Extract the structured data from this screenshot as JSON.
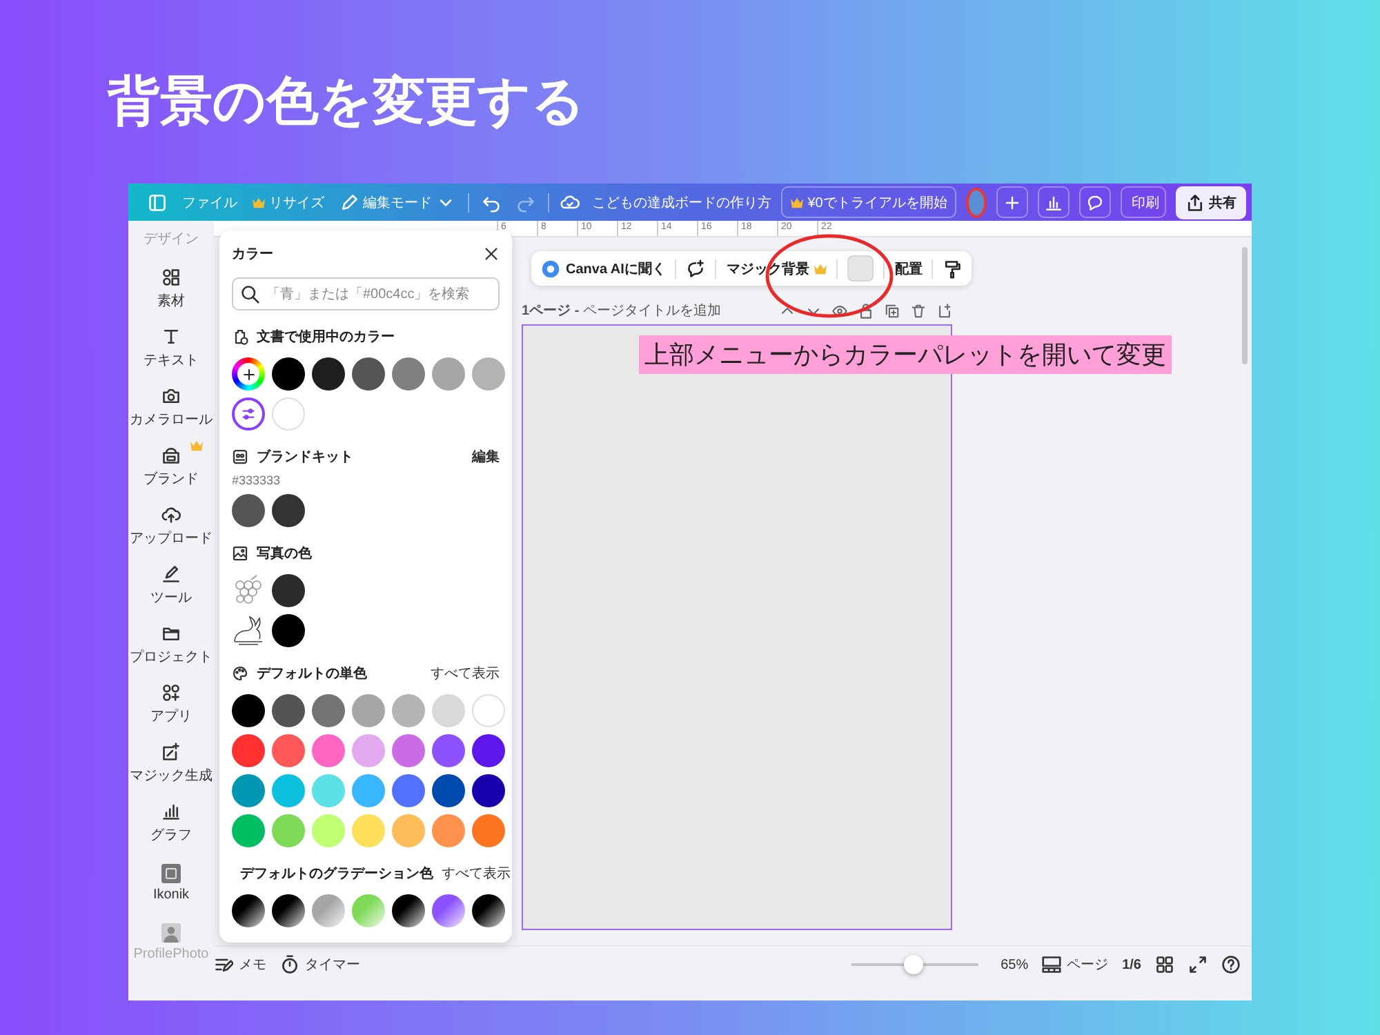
{
  "slide_title": "背景の色を変更する",
  "topbar": {
    "menu": [
      {
        "label": "ファイル",
        "premium": false
      },
      {
        "label": "リサイズ",
        "premium": true
      }
    ],
    "edit_mode": "編集モード",
    "redo_disabled": true,
    "doc_title": "こどもの達成ボードの作り方",
    "trial": {
      "label": "¥0でトライアルを開始",
      "premium": true
    },
    "avatar_circled": true,
    "print": "印刷",
    "share": "共有"
  },
  "rail": {
    "header": "デザイン",
    "items": [
      {
        "label": "素材",
        "premium": false
      },
      {
        "label": "テキスト",
        "premium": false
      },
      {
        "label": "カメラロール",
        "premium": false
      },
      {
        "label": "ブランド",
        "premium": true
      },
      {
        "label": "アップロード",
        "premium": false
      },
      {
        "label": "ツール",
        "premium": false
      },
      {
        "label": "プロジェクト",
        "premium": false
      },
      {
        "label": "アプリ",
        "premium": false
      },
      {
        "label": "マジック生成",
        "premium": false
      },
      {
        "label": "グラフ",
        "premium": false
      },
      {
        "label": "Ikonik",
        "premium": false
      },
      {
        "label": "ProfilePhoto",
        "premium": false
      }
    ]
  },
  "ruler": [
    "6",
    "8",
    "10",
    "12",
    "14",
    "16",
    "18",
    "20",
    "22"
  ],
  "color_panel": {
    "title": "カラー",
    "search": {
      "placeholder": "「青」または「#00c4cc」を検索"
    },
    "sections": [
      {
        "kind": "document",
        "header": "文書で使用中のカラー",
        "rows": [
          [
            {
              "kind": "add"
            },
            {
              "kind": "swatch",
              "color": "#000000"
            },
            {
              "kind": "swatch",
              "color": "#1f1f1f"
            },
            {
              "kind": "swatch",
              "color": "#555555"
            },
            {
              "kind": "swatch",
              "color": "#808080"
            },
            {
              "kind": "swatch",
              "color": "#a6a6a6"
            },
            {
              "kind": "swatch",
              "color": "#b3b3b3"
            }
          ],
          [
            {
              "kind": "picker"
            },
            {
              "kind": "swatch",
              "color": "#ffffff"
            }
          ]
        ]
      },
      {
        "kind": "brand",
        "header": "ブランドキット",
        "action": "編集",
        "caption": "#333333",
        "rows": [
          [
            {
              "kind": "swatch",
              "color": "#555555"
            },
            {
              "kind": "swatch",
              "color": "#333333"
            }
          ]
        ]
      },
      {
        "kind": "photo",
        "header": "写真の色",
        "rows": [
          [
            {
              "kind": "photo"
            },
            {
              "kind": "swatch",
              "color": "#2b2b2b"
            }
          ],
          [
            {
              "kind": "photo"
            },
            {
              "kind": "swatch",
              "color": "#000000"
            }
          ]
        ]
      },
      {
        "kind": "default",
        "header": "デフォルトの単色",
        "action": "すべて表示",
        "rows": [
          [
            {
              "kind": "swatch",
              "color": "#000000"
            },
            {
              "kind": "swatch",
              "color": "#545454"
            },
            {
              "kind": "swatch",
              "color": "#737373"
            },
            {
              "kind": "swatch",
              "color": "#a6a6a6"
            },
            {
              "kind": "swatch",
              "color": "#b4b4b4"
            },
            {
              "kind": "swatch",
              "color": "#d9d9d9"
            },
            {
              "kind": "swatch",
              "color": "#ffffff"
            }
          ],
          [
            {
              "kind": "swatch",
              "color": "#ff3131"
            },
            {
              "kind": "swatch",
              "color": "#ff5757"
            },
            {
              "kind": "swatch",
              "color": "#ff66c4"
            },
            {
              "kind": "swatch",
              "color": "#e2a9f1"
            },
            {
              "kind": "swatch",
              "color": "#cb6ce6"
            },
            {
              "kind": "swatch",
              "color": "#8c52ff"
            },
            {
              "kind": "swatch",
              "color": "#5e17eb"
            }
          ],
          [
            {
              "kind": "swatch",
              "color": "#0097b2"
            },
            {
              "kind": "swatch",
              "color": "#0cc0df"
            },
            {
              "kind": "swatch",
              "color": "#5ce1e6"
            },
            {
              "kind": "swatch",
              "color": "#38b6ff"
            },
            {
              "kind": "swatch",
              "color": "#5271ff"
            },
            {
              "kind": "swatch",
              "color": "#004aad"
            },
            {
              "kind": "swatch",
              "color": "#1800ad"
            }
          ],
          [
            {
              "kind": "swatch",
              "color": "#00bf63"
            },
            {
              "kind": "swatch",
              "color": "#7ed957"
            },
            {
              "kind": "swatch",
              "color": "#c1ff72"
            },
            {
              "kind": "swatch",
              "color": "#ffde59"
            },
            {
              "kind": "swatch",
              "color": "#ffbd59"
            },
            {
              "kind": "swatch",
              "color": "#ff914d"
            },
            {
              "kind": "swatch",
              "color": "#ff751f"
            }
          ]
        ]
      },
      {
        "kind": "gradient",
        "header": "デフォルトのグラデーション色",
        "action": "すべて表示",
        "rows": [
          [
            {
              "kind": "gradient",
              "color": "#000000"
            },
            {
              "kind": "gradient",
              "color": "#000000"
            },
            {
              "kind": "gradient",
              "color": "#a6a6a6"
            },
            {
              "kind": "gradient",
              "color": "#7ed957"
            },
            {
              "kind": "gradient",
              "color": "#000000"
            },
            {
              "kind": "gradient",
              "color": "#8c52ff"
            },
            {
              "kind": "gradient",
              "color": "#000000"
            }
          ]
        ]
      }
    ]
  },
  "toolbar": [
    {
      "kind": "ai",
      "label": "Canva AIに聞く"
    },
    {
      "kind": "comment"
    },
    {
      "kind": "magic",
      "label": "マジック背景",
      "premium": true
    },
    {
      "kind": "color",
      "color": "#e6e6e6"
    },
    {
      "kind": "text",
      "label": "配置"
    },
    {
      "kind": "roller"
    }
  ],
  "page_header": "**1ページ -** ページタイトルを追加",
  "callout": "上部メニューからカラーパレットを開いて変更",
  "bottom_bar": {
    "memo": "メモ",
    "timer": "タイマー",
    "zoom": {
      "level": 0.49,
      "reading": "65%"
    },
    "pages_label": "ページ",
    "page_count": "1/6"
  }
}
